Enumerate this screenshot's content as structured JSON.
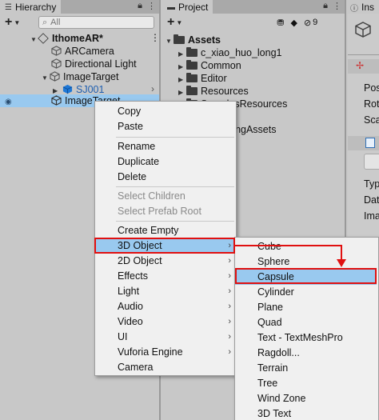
{
  "colors": {
    "accent": "#e01010",
    "selection": "#99c9ef",
    "object_icon": "#1f78d6"
  },
  "hierarchy": {
    "tab": "Hierarchy",
    "search_placeholder": "All",
    "scene": "IthomeAR*",
    "items": [
      "ARCamera",
      "Directional Light",
      "ImageTarget",
      "SJ001",
      "ImageTarget"
    ]
  },
  "project": {
    "tab": "Project",
    "badge_count": "9",
    "root": "Assets",
    "folders": [
      "c_xiao_huo_long1",
      "Common",
      "Editor",
      "Resources",
      "SamplesResources",
      "StreamingAssets"
    ]
  },
  "inspector": {
    "tab": "Ins",
    "labels": [
      "Pos",
      "Rot",
      "Sca",
      "Typ",
      "Dat",
      "Ima"
    ]
  },
  "context_menu": {
    "items": [
      "Copy",
      "Paste",
      "Rename",
      "Duplicate",
      "Delete",
      "Select Children",
      "Select Prefab Root",
      "Create Empty",
      "3D Object",
      "2D Object",
      "Effects",
      "Light",
      "Audio",
      "Video",
      "UI",
      "Vuforia Engine",
      "Camera"
    ]
  },
  "submenu": {
    "items": [
      "Cube",
      "Sphere",
      "Capsule",
      "Cylinder",
      "Plane",
      "Quad",
      "Text - TextMeshPro",
      "Ragdoll...",
      "Terrain",
      "Tree",
      "Wind Zone",
      "3D Text"
    ]
  }
}
